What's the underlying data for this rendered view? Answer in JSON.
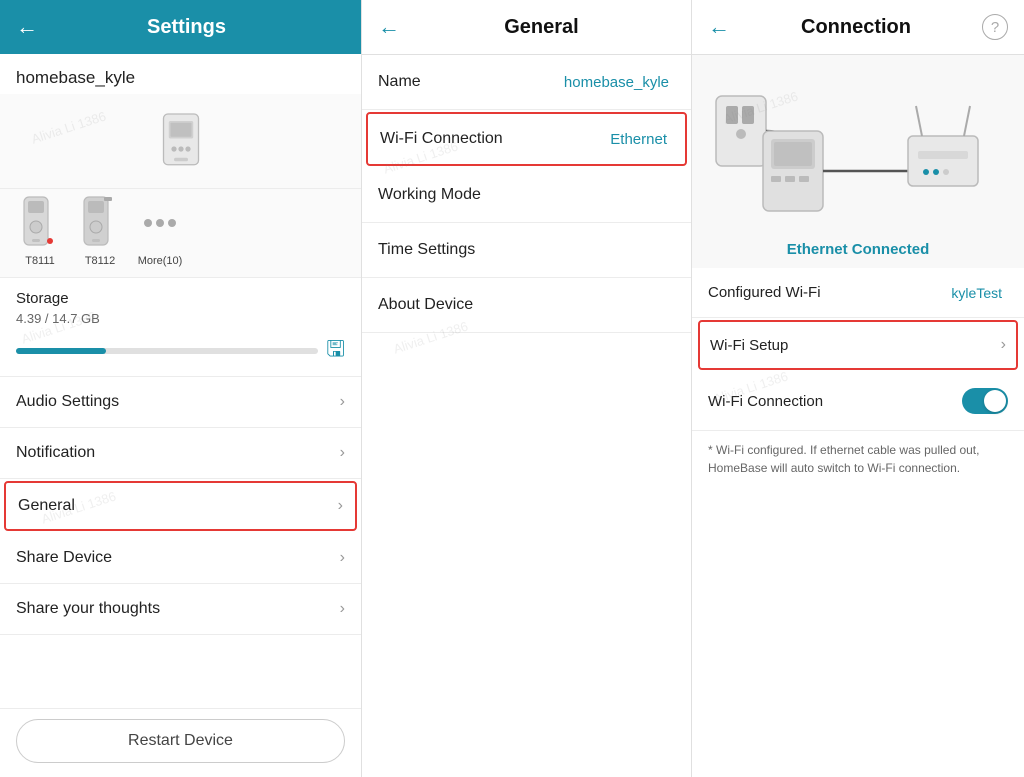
{
  "settings": {
    "title": "Settings",
    "back_label": "←",
    "device_name": "homebase_kyle",
    "storage": {
      "label": "Storage",
      "used": "4.39",
      "total": "14.7 GB",
      "sub": "4.39 / 14.7 GB",
      "fill_pct": 29.8
    },
    "devices": [
      {
        "label": "T8111"
      },
      {
        "label": "T8112"
      },
      {
        "label": "More(10)"
      }
    ],
    "menu_items": [
      {
        "id": "audio",
        "label": "Audio Settings"
      },
      {
        "id": "notification",
        "label": "Notification"
      },
      {
        "id": "general",
        "label": "General",
        "selected": true
      },
      {
        "id": "share_device",
        "label": "Share Device"
      },
      {
        "id": "share_thoughts",
        "label": "Share your thoughts"
      }
    ],
    "restart_label": "Restart Device"
  },
  "general": {
    "title": "General",
    "back_label": "←",
    "items": [
      {
        "id": "name",
        "label": "Name",
        "value": "homebase_kyle",
        "highlighted": false
      },
      {
        "id": "wifi",
        "label": "Wi-Fi Connection",
        "value": "Ethernet",
        "highlighted": true
      },
      {
        "id": "working_mode",
        "label": "Working Mode",
        "value": "",
        "highlighted": false
      },
      {
        "id": "time_settings",
        "label": "Time Settings",
        "value": "",
        "highlighted": false
      },
      {
        "id": "about_device",
        "label": "About Device",
        "value": "",
        "highlighted": false
      }
    ]
  },
  "connection": {
    "title": "Connection",
    "back_label": "←",
    "help_icon": "?",
    "status_label": "Ethernet Connected",
    "configured_wifi_label": "Configured Wi-Fi",
    "configured_wifi_value": "kyleTest",
    "wifi_setup_label": "Wi-Fi Setup",
    "wifi_connection_label": "Wi-Fi Connection",
    "wifi_connection_enabled": true,
    "note": "* Wi-Fi configured. If ethernet cable was pulled out, HomeBase will auto switch to Wi-Fi connection.",
    "items": [
      {
        "id": "configured_wifi",
        "label": "Configured Wi-Fi",
        "value": "kyleTest",
        "type": "value",
        "highlighted": false
      },
      {
        "id": "wifi_setup",
        "label": "Wi-Fi Setup",
        "value": "",
        "type": "chevron",
        "highlighted": true
      },
      {
        "id": "wifi_connection",
        "label": "Wi-Fi Connection",
        "value": "",
        "type": "toggle",
        "highlighted": false
      }
    ]
  },
  "watermarks": [
    "Alivia Li 1386",
    "Alivia Li 1386",
    "Alivia Li 1386"
  ],
  "colors": {
    "accent": "#1a8fa8",
    "danger": "#e53935",
    "header_bg": "#1a8fa8"
  }
}
